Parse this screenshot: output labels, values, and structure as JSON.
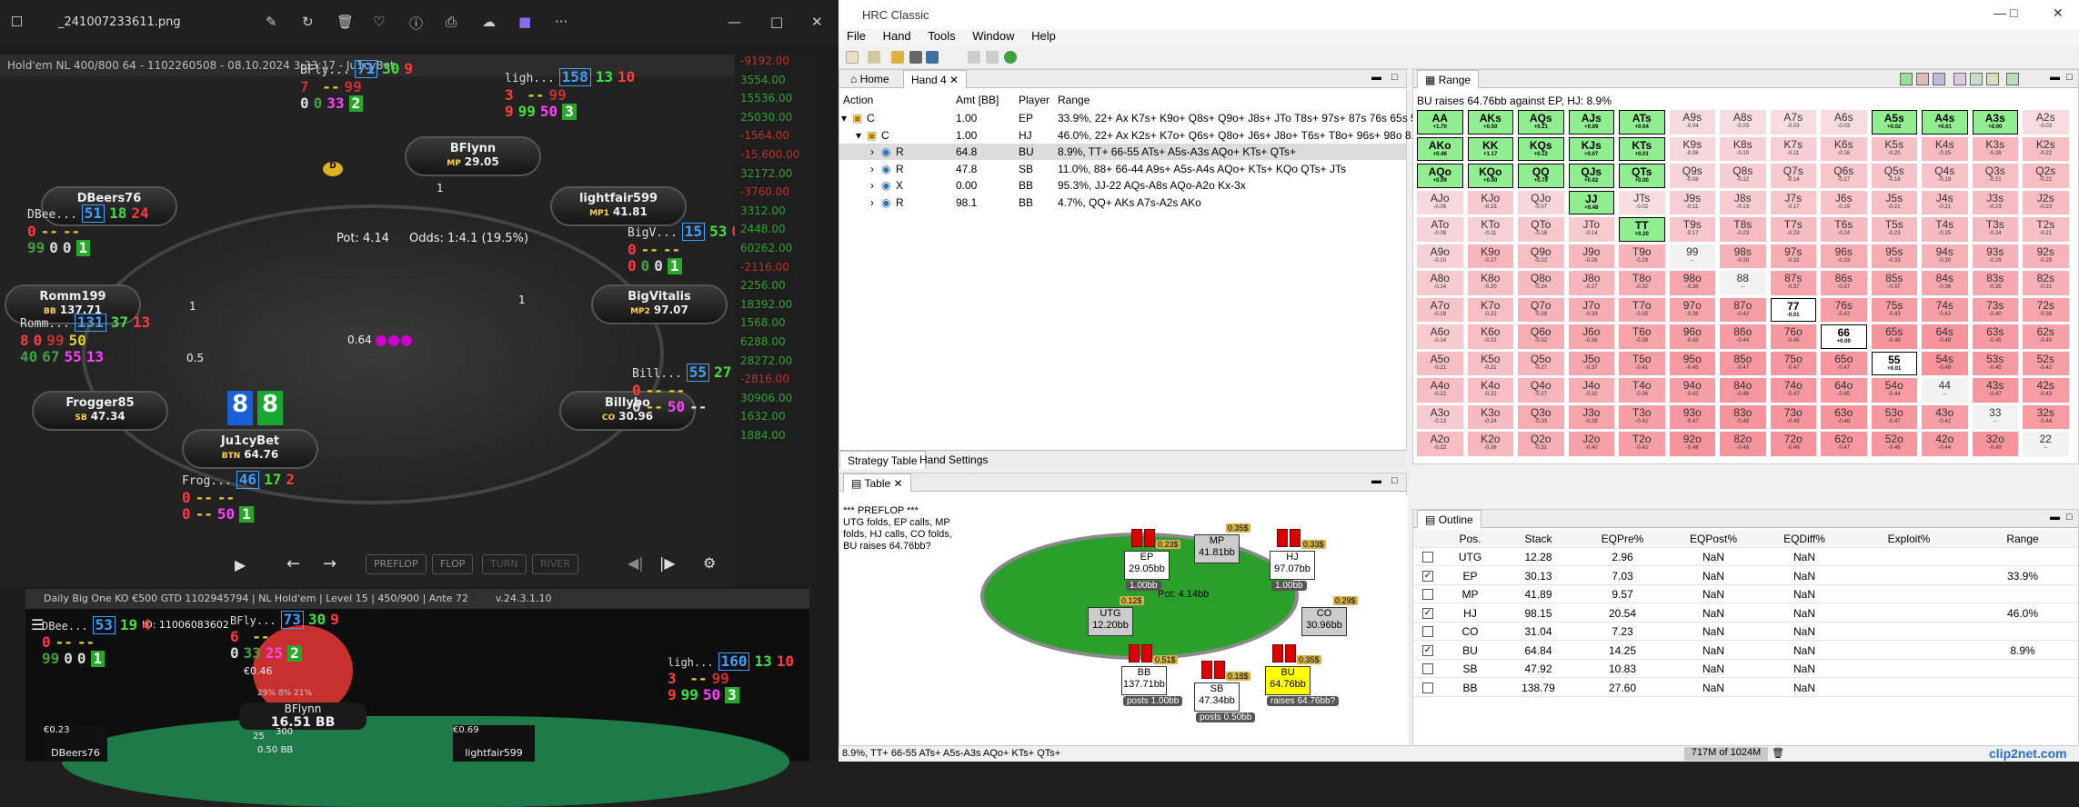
{
  "viewer": {
    "filename": "_241007233611.png"
  },
  "replay": {
    "header": "Hold'em NL 400/800 64 - 1102260508 - 08.10.2024 3:33:17 - Ju1cyBet",
    "pot": "Pot:  4.14",
    "odds": "Odds:  1:4.1 (19.5%)",
    "board_amount": "0.64",
    "hero_cards": [
      "8",
      "8"
    ],
    "seats": [
      {
        "name": "BFlynn",
        "pos": "MP",
        "stack": "29.05"
      },
      {
        "name": "lightfair599",
        "pos": "MP1",
        "stack": "41.81"
      },
      {
        "name": "BigVitalis",
        "pos": "MP2",
        "stack": "97.07"
      },
      {
        "name": "Billybo",
        "pos": "CO",
        "stack": "30.96"
      },
      {
        "name": "Ju1cyBet",
        "pos": "BTN",
        "stack": "64.76"
      },
      {
        "name": "Frogger85",
        "pos": "SB",
        "stack": "47.34"
      },
      {
        "name": "Romm199",
        "pos": "BB",
        "stack": "137.71"
      },
      {
        "name": "DBeers76",
        "pos": "",
        "stack": ""
      }
    ],
    "bet_labels": {
      "bflynn": "1",
      "bigv": "1",
      "romm": "1",
      "frog": "0.5"
    },
    "hud": {
      "bfly": {
        "tag": "BFly...",
        "a": "71",
        "b": "30",
        "c": "9",
        "r2": [
          "7",
          "--",
          "99"
        ],
        "r3": [
          "0",
          "0",
          "33",
          "2"
        ]
      },
      "ligh": {
        "tag": "ligh...",
        "a": "158",
        "b": "13",
        "c": "10",
        "r2": [
          "3",
          "--",
          "99"
        ],
        "r3": [
          "9",
          "99",
          "50",
          "3"
        ]
      },
      "dbee": {
        "tag": "DBee...",
        "a": "51",
        "b": "18",
        "c": "24",
        "r2": [
          "0",
          "--",
          "--"
        ],
        "r3": [
          "99",
          "0",
          "0",
          "1"
        ]
      },
      "bigv": {
        "tag": "BigV...",
        "a": "15",
        "b": "53",
        "c": "0",
        "r2": [
          "0",
          "--",
          "--"
        ],
        "r3": [
          "0",
          "0",
          "0",
          "1"
        ]
      },
      "romm": {
        "tag": "Romm...",
        "a": "131",
        "b": "37",
        "c": "13",
        "r2": [
          "8",
          "0",
          "99",
          "50"
        ],
        "r3": [
          "40",
          "67",
          "55",
          "13"
        ]
      },
      "bill": {
        "tag": "Bill...",
        "a": "55",
        "b": "27",
        "c": "6",
        "r2": [
          "0",
          "--",
          "--"
        ],
        "r3": [
          "0",
          "--",
          "50",
          "--"
        ]
      },
      "frog": {
        "tag": "Frog...",
        "a": "46",
        "b": "17",
        "c": "2",
        "r2": [
          "0",
          "--",
          "--"
        ],
        "r3": [
          "0",
          "--",
          "50",
          "1"
        ]
      }
    },
    "sidebar": [
      "-9192.00",
      "3554.00",
      "15536.00",
      "25030.00",
      "-1564.00",
      "-15,600.00",
      "32172.00",
      "-3760.00",
      "3312.00",
      "2448.00",
      "60262.00",
      "-2116.00",
      "2256.00",
      "18392.00",
      "1568.00",
      "6288.00",
      "28272.00",
      "-2816.00",
      "30906.00",
      "1632.00",
      "1884.00"
    ],
    "controls": [
      "PREFLOP",
      "FLOP",
      "TURN",
      "RIVER"
    ]
  },
  "tournament": {
    "title": "Daily Big One KO €500 GTD 1102945794 | NL Hold'em | Level 15 | 450/900 | Ante 72",
    "version": "v.24.3.1.10",
    "id": "ID: 11006083602",
    "hero": {
      "name": "BFlynn",
      "stack": "16.51 BB",
      "bounty": "€0.46"
    },
    "left": {
      "name": "DBeers76",
      "bounty": "€0.23"
    },
    "right": {
      "name": "lightfair599",
      "bounty": "€0.69"
    },
    "pot": "0.50 BB",
    "chip": "25",
    "chip2": "300",
    "pcts": [
      "29%",
      "8%",
      "21%"
    ],
    "hud": {
      "dbee": {
        "tag": "DBee...",
        "a": "53",
        "b": "19",
        "c": "4",
        "r2": [
          "0",
          "--",
          "--"
        ],
        "r3": [
          "99",
          "0",
          "0",
          "1"
        ]
      },
      "bfly": {
        "tag": "BFly...",
        "a": "73",
        "b": "30",
        "c": "9",
        "r2": [
          "6",
          "--",
          "99"
        ],
        "r3": [
          "0",
          "33",
          "25",
          "2"
        ]
      },
      "ligh": {
        "tag": "ligh...",
        "a": "160",
        "b": "13",
        "c": "10",
        "r2": [
          "3",
          "--",
          "99"
        ],
        "r3": [
          "9",
          "99",
          "50",
          "3"
        ]
      }
    }
  },
  "hrc": {
    "title": "HRC Classic",
    "menu": [
      "File",
      "Hand",
      "Tools",
      "Window",
      "Help"
    ],
    "hand_tabs": {
      "home": "Home",
      "hand": "Hand 4"
    },
    "action_headers": [
      "Action",
      "Amt [BB]",
      "Player",
      "Range"
    ],
    "actions": [
      {
        "act": "C",
        "amt": "1.00",
        "player": "EP",
        "range": "33.9%, 22+ Ax K7s+ K9o+ Q8s+ Q9o+ J8s+ JTo T8s+ 97s+ 87s 76s 65s 54s"
      },
      {
        "act": "C",
        "amt": "1.00",
        "player": "HJ",
        "range": "46.0%, 22+ Ax K2s+ K7o+ Q6s+ Q8o+ J6s+ J8o+ T6s+ T8o+ 96s+ 98o 8..."
      },
      {
        "act": "R",
        "amt": "64.8",
        "player": "BU",
        "range": "8.9%, TT+ 66-55 ATs+ A5s-A3s AQo+ KTs+ QTs+"
      },
      {
        "act": "R",
        "amt": "47.8",
        "player": "SB",
        "range": "11.0%, 88+ 66-44 A9s+ A5s-A4s AQo+ KTs+ KQo QTs+ JTs"
      },
      {
        "act": "X",
        "amt": "0.00",
        "player": "BB",
        "range": "95.3%, JJ-22 AQs-A8s AQo-A2o Kx-3x"
      },
      {
        "act": "R",
        "amt": "98.1",
        "player": "BB",
        "range": "4.7%, QQ+ AKs A7s-A2s AKo"
      }
    ],
    "bottom_tabs": [
      "Strategy Table",
      "Hand Settings"
    ],
    "range_title": "Range",
    "range_caption": "BU raises 64.76bb against EP, HJ: 8.9%",
    "range_values": [
      [
        "+1.70",
        "+0.50",
        "+0.21",
        "+0.09",
        "+0.04",
        "-0.04",
        "-0.03",
        "-0.03",
        "-0.03",
        "+0.02",
        "+0.01",
        "+0.00",
        "-0.03"
      ],
      [
        "+0.46",
        "+1.17",
        "+0.12",
        "+0.07",
        "+0.01",
        "-0.06",
        "-0.10",
        "-0.11",
        "-0.16",
        "-0.20",
        "-0.25",
        "-0.26",
        "-0.22"
      ],
      [
        "+0.09",
        "+0.00",
        "+0.79",
        "+0.02",
        "+0.00",
        "-0.08",
        "-0.12",
        "-0.14",
        "-0.17",
        "-0.18",
        "-0.19",
        "-0.21",
        "-0.22"
      ],
      [
        "-0.05",
        "-0.15",
        "-0.07",
        "+0.48",
        "-0.02",
        "-0.11",
        "-0.13",
        "-0.17",
        "-0.19",
        "-0.21",
        "-0.21",
        "-0.23",
        "-0.23"
      ],
      [
        "-0.08",
        "-0.11",
        "-0.16",
        "-0.14",
        "+0.20",
        "-0.17",
        "-0.23",
        "-0.23",
        "-0.24",
        "-0.23",
        "-0.25",
        "-0.24",
        "-0.21"
      ],
      [
        "-0.10",
        "-0.27",
        "-0.22",
        "-0.26",
        "-0.29",
        "--",
        "-0.30",
        "-0.32",
        "-0.33",
        "-0.33",
        "-0.30",
        "-0.29",
        "-0.29"
      ],
      [
        "-0.14",
        "-0.20",
        "-0.24",
        "-0.27",
        "-0.32",
        "-0.36",
        "--",
        "-0.37",
        "-0.37",
        "-0.37",
        "-0.36",
        "-0.35",
        "-0.31"
      ],
      [
        "-0.18",
        "-0.22",
        "-0.28",
        "-0.33",
        "-0.35",
        "-0.38",
        "-0.42",
        "-0.01",
        "-0.42",
        "-0.43",
        "-0.42",
        "-0.40",
        "-0.38"
      ],
      [
        "-0.14",
        "-0.22",
        "-0.32",
        "-0.36",
        "-0.39",
        "-0.42",
        "-0.44",
        "-0.45",
        "+0.00",
        "-0.48",
        "-0.48",
        "-0.45",
        "-0.40"
      ],
      [
        "-0.21",
        "-0.21",
        "-0.27",
        "-0.37",
        "-0.41",
        "-0.45",
        "-0.47",
        "-0.47",
        "-0.47",
        "+0.01",
        "-0.49",
        "-0.45",
        "-0.42"
      ],
      [
        "-0.22",
        "-0.22",
        "-0.27",
        "-0.32",
        "-0.36",
        "-0.42",
        "-0.46",
        "-0.47",
        "-0.45",
        "-0.44",
        "--",
        "-0.47",
        "-0.43"
      ],
      [
        "-0.13",
        "-0.24",
        "-0.33",
        "-0.39",
        "-0.42",
        "-0.47",
        "-0.49",
        "-0.49",
        "-0.48",
        "-0.47",
        "-0.42",
        "--",
        "-0.44"
      ],
      [
        "-0.22",
        "-0.26",
        "-0.31",
        "-0.40",
        "-0.42",
        "-0.48",
        "-0.48",
        "-0.49",
        "-0.47",
        "-0.46",
        "-0.44",
        "-0.49",
        "--"
      ]
    ],
    "table_title": "Table",
    "history": [
      "*** PREFLOP ***",
      "UTG folds, EP calls, MP",
      "folds, HJ calls, CO folds,",
      "BU raises 64.76bb?"
    ],
    "tseats": [
      {
        "name": "MP",
        "stack": "41.81bb",
        "bet": "0.35$"
      },
      {
        "name": "EP",
        "stack": "29.05bb",
        "bet": "0.23$",
        "sub": "1.00bb"
      },
      {
        "name": "HJ",
        "stack": "97.07bb",
        "bet": "0.33$",
        "sub": "1.00bb"
      },
      {
        "name": "UTG",
        "stack": "12.20bb",
        "bet": "0.12$"
      },
      {
        "name": "CO",
        "stack": "30.96bb",
        "bet": "0.29$"
      },
      {
        "name": "BB",
        "stack": "137.71bb",
        "bet": "0.51$",
        "sub": "posts 1.00bb"
      },
      {
        "name": "SB",
        "stack": "47.34bb",
        "bet": "0.18$",
        "sub": "posts 0.50bb"
      },
      {
        "name": "BU",
        "stack": "64.76bb",
        "bet": "0.35$",
        "sub": "raises 64.76bb?"
      }
    ],
    "tpot": "Pot:     4.14bb",
    "outline_title": "Outline",
    "outline_headers": [
      "Pos.",
      "Stack",
      "EQPre%",
      "EQPost%",
      "EQDiff%",
      "Exploit%",
      "Range"
    ],
    "outline": [
      {
        "pos": "UTG",
        "stack": "12.28",
        "eqpre": "2.96",
        "eqpost": "NaN",
        "eqdiff": "NaN",
        "exploit": "",
        "range": "",
        "chk": false
      },
      {
        "pos": "EP",
        "stack": "30.13",
        "eqpre": "7.03",
        "eqpost": "NaN",
        "eqdiff": "NaN",
        "exploit": "",
        "range": "33.9%",
        "chk": true
      },
      {
        "pos": "MP",
        "stack": "41.89",
        "eqpre": "9.57",
        "eqpost": "NaN",
        "eqdiff": "NaN",
        "exploit": "",
        "range": "",
        "chk": false
      },
      {
        "pos": "HJ",
        "stack": "98.15",
        "eqpre": "20.54",
        "eqpost": "NaN",
        "eqdiff": "NaN",
        "exploit": "",
        "range": "46.0%",
        "chk": true
      },
      {
        "pos": "CO",
        "stack": "31.04",
        "eqpre": "7.23",
        "eqpost": "NaN",
        "eqdiff": "NaN",
        "exploit": "",
        "range": "",
        "chk": false
      },
      {
        "pos": "BU",
        "stack": "64.84",
        "eqpre": "14.25",
        "eqpost": "NaN",
        "eqdiff": "NaN",
        "exploit": "",
        "range": "8.9%",
        "chk": true
      },
      {
        "pos": "SB",
        "stack": "47.92",
        "eqpre": "10.83",
        "eqpost": "NaN",
        "eqdiff": "NaN",
        "exploit": "",
        "range": "",
        "chk": false
      },
      {
        "pos": "BB",
        "stack": "138.79",
        "eqpre": "27.60",
        "eqpost": "NaN",
        "eqdiff": "NaN",
        "exploit": "",
        "range": "",
        "chk": false
      }
    ],
    "status_text": "8.9%, TT+ 66-55 ATs+ A5s-A3s AQo+ KTs+ QTs+",
    "memory": "717M of 1024M",
    "watermark": "clip2net.com"
  },
  "colors": {
    "selected_green": "#90ee90",
    "heat_pink": "#f4a6ae",
    "yellow": "#ffff00"
  }
}
